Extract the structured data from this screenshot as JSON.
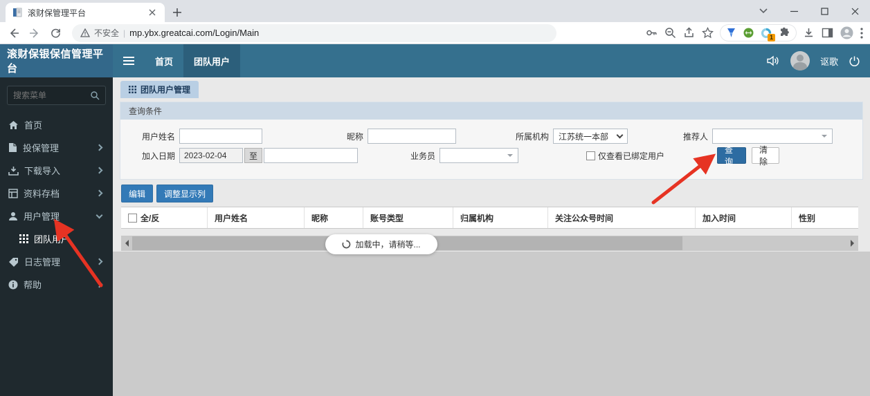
{
  "browser": {
    "tab_title": "滚财保管理平台",
    "security_label": "不安全",
    "url": "mp.ybx.greatcai.com/Login/Main",
    "extension_badge": "1"
  },
  "navbar": {
    "brand": "滚财保银保信管理平台",
    "items": [
      {
        "label": "首页"
      },
      {
        "label": "团队用户"
      }
    ],
    "username": "讴歌"
  },
  "sidebar": {
    "search_placeholder": "搜索菜单",
    "items": [
      {
        "label": "首页"
      },
      {
        "label": "投保管理"
      },
      {
        "label": "下载导入"
      },
      {
        "label": "资料存档"
      },
      {
        "label": "用户管理"
      },
      {
        "label": "团队用户"
      },
      {
        "label": "日志管理"
      },
      {
        "label": "帮助"
      }
    ]
  },
  "main": {
    "tab_label": "团队用户管理",
    "query": {
      "title": "查询条件",
      "username_label": "用户姓名",
      "nickname_label": "昵称",
      "org_label": "所属机构",
      "org_value": "江苏统一本部",
      "referrer_label": "推荐人",
      "join_date_label": "加入日期",
      "join_date_value": "2023-02-04",
      "to_label": "至",
      "salesman_label": "业务员",
      "bound_only_label": "仅查看已绑定用户",
      "search_button": "查询",
      "clear_button": "清除"
    },
    "toolbar": {
      "edit_button": "编辑",
      "adjust_columns_button": "调整显示列"
    },
    "table": {
      "headers": [
        "全/反",
        "用户姓名",
        "昵称",
        "账号类型",
        "归属机构",
        "关注公众号时间",
        "加入时间",
        "性别"
      ]
    },
    "loading_text": "加载中，请稍等..."
  },
  "colors": {
    "navbar": "#35708e",
    "sidebar": "#1f292e",
    "accent_blue": "#337ab7",
    "tab_blue": "#b9cfe4",
    "arrow_red": "#e63323"
  }
}
